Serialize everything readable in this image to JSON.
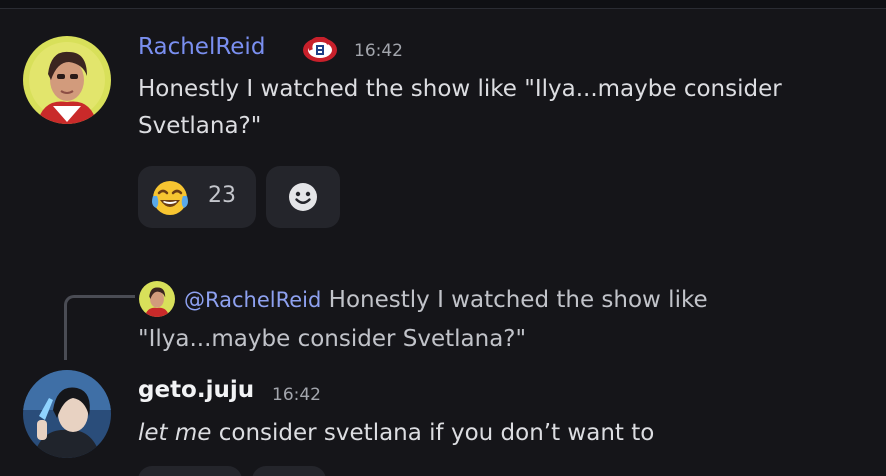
{
  "colors": {
    "background": "#151519",
    "username_rachel": "#7a8ff0",
    "username_geto": "#f2f3f5",
    "mention": "#8ea1f0",
    "reaction_bg": "#24252b"
  },
  "messages": [
    {
      "username": "RachelReid",
      "badge_icon": "habs-logo-icon",
      "timestamp": "16:42",
      "text": "Honestly I watched the show like \"Ilya...maybe consider Svetlana?\"",
      "reactions": [
        {
          "emoji_icon": "joy-emoji-icon",
          "count": "23"
        }
      ],
      "add_reaction_icon": "smiley-add-reaction-icon"
    },
    {
      "reply": {
        "mention": "@RachelReid",
        "text": "Honestly I watched the show like \"Ilya...maybe consider Svetlana?\""
      },
      "username": "geto.juju",
      "timestamp": "16:42",
      "text_italic": "let me",
      "text_rest": " consider svetlana if you don’t want to"
    }
  ]
}
